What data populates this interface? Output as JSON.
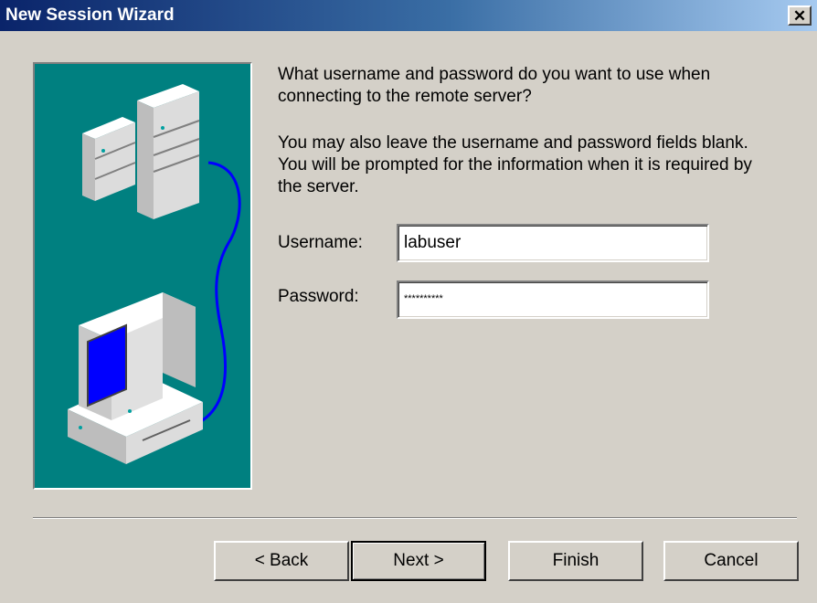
{
  "window": {
    "title": "New Session Wizard",
    "close_icon": "close-icon"
  },
  "content": {
    "prompt": "What username and password do you want to use when connecting to the remote server?",
    "hint": "You may also leave the username and password fields blank.  You will be prompted for the information when it is required by the server."
  },
  "form": {
    "username_label": "Username:",
    "username_value": "labuser",
    "password_label": "Password:",
    "password_value": "**********"
  },
  "buttons": {
    "back": "< Back",
    "next": "Next >",
    "finish": "Finish",
    "cancel": "Cancel"
  },
  "colors": {
    "art_background": "#008080",
    "dialog_face": "#d4d0c8",
    "title_start": "#0a246a"
  }
}
